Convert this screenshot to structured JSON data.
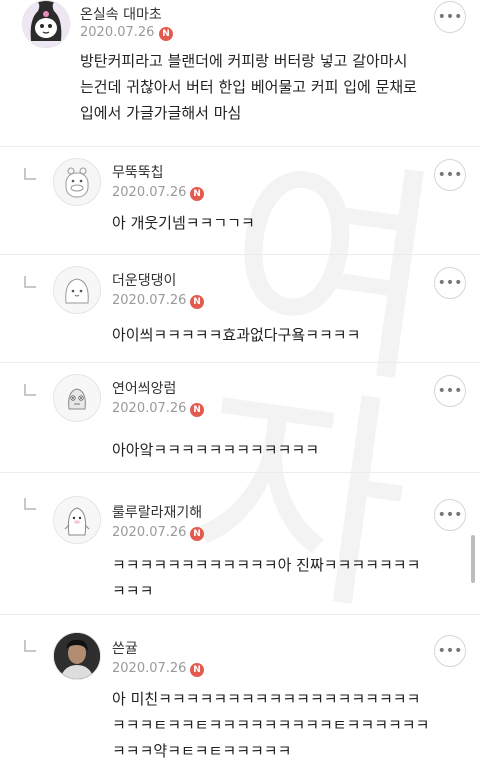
{
  "watermark": "여자",
  "more_icon_label": "•••",
  "badge_label": "N",
  "comments": [
    {
      "nickname": "온실속 대마초",
      "date": "2020.07.26",
      "text": "방탄커피라고 블랜더에 커피랑 버터랑 넣고 갈아마시\n는건데 귀찮아서 버터 한입 베어물고 커피 입에 문채로\n입에서 가글가글해서 마심"
    }
  ],
  "replies": [
    {
      "nickname": "무뚝뚝칩",
      "date": "2020.07.26",
      "text": "아 개웃기넴ㅋㅋㄱㄱㅋ"
    },
    {
      "nickname": "더운댕댕이",
      "date": "2020.07.26",
      "text": "아이씌ㅋㅋㅋㅋㅋ효과없다구욬ㅋㅋㅋㅋ"
    },
    {
      "nickname": "연어씌앙럼",
      "date": "2020.07.26",
      "text": "아아앜ㅋㅋㅋㅋㅋㅋㅋㅋㅋㅋㅋㅋ"
    },
    {
      "nickname": "룰루랄라재기해",
      "date": "2020.07.26",
      "text": "ㅋㅋㅋㅋㅋㅋㅋㅋㅋㅋㅋㅋ아 진짜ㅋㅋㅋㅋㅋㅋㅋ\nㅋㅋㅋ"
    },
    {
      "nickname": "쓴귤",
      "date": "2020.07.26",
      "text": "아 미친ㅋㅋㅋㅋㅋㅋㅋㅋㅋㅋㅋㅋㅋㅋㅋㅋㅋㅋㅋ\nㅋㅋㅋㅌㅋㅋㅌㅋㅋㅋㅋㅋㅋㅋㅋㅋㅌㅋㅋㅋㅋㅋㅋ\nㅋㅋㅋ약ㅋㅌㅋㅌㅋㅋㅋㅋㅋ"
    }
  ]
}
